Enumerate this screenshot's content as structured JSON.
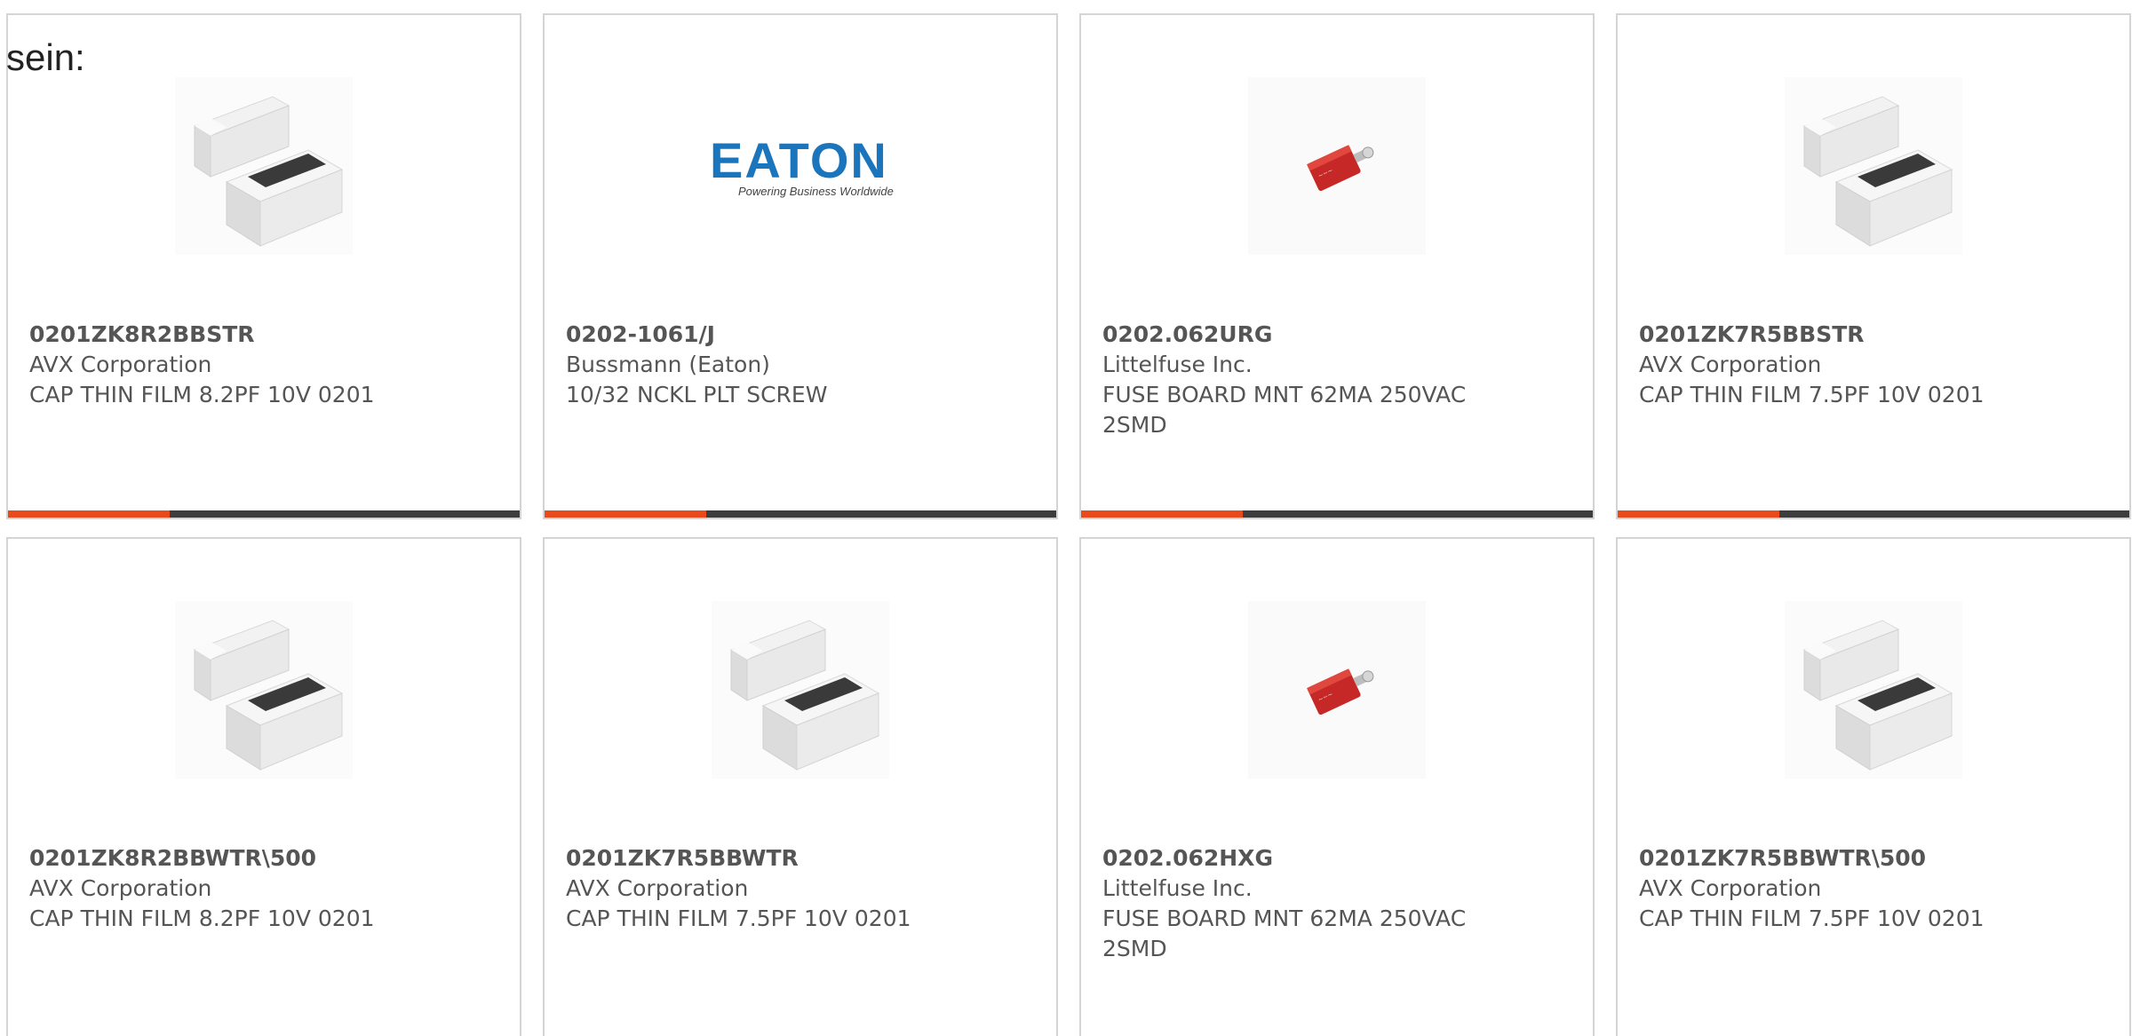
{
  "intro_text": "sein:",
  "colors": {
    "accent": "#e84a1c",
    "bar_dark": "#3d3d3d",
    "text": "#555555",
    "border": "#d4d4d4"
  },
  "products": [
    {
      "part_number": "0201ZK8R2BBSTR",
      "manufacturer": "AVX Corporation",
      "description": "CAP THIN FILM 8.2PF 10V 0201",
      "image": "capacitor-chip-icon",
      "logo_text": "",
      "logo_tagline": ""
    },
    {
      "part_number": "0202-1061/J",
      "manufacturer": "Bussmann (Eaton)",
      "description": "10/32 NCKL PLT SCREW",
      "image": "eaton-logo",
      "logo_text": "EATON",
      "logo_tagline": "Powering Business Worldwide"
    },
    {
      "part_number": "0202.062URG",
      "manufacturer": "Littelfuse Inc.",
      "description": "FUSE BOARD MNT 62MA 250VAC 2SMD",
      "image": "fuse-icon",
      "logo_text": "",
      "logo_tagline": ""
    },
    {
      "part_number": "0201ZK7R5BBSTR",
      "manufacturer": "AVX Corporation",
      "description": "CAP THIN FILM 7.5PF 10V 0201",
      "image": "capacitor-chip-icon",
      "logo_text": "",
      "logo_tagline": ""
    },
    {
      "part_number": "0201ZK8R2BBWTR\\500",
      "manufacturer": "AVX Corporation",
      "description": "CAP THIN FILM 8.2PF 10V 0201",
      "image": "capacitor-chip-icon",
      "logo_text": "",
      "logo_tagline": ""
    },
    {
      "part_number": "0201ZK7R5BBWTR",
      "manufacturer": "AVX Corporation",
      "description": "CAP THIN FILM 7.5PF 10V 0201",
      "image": "capacitor-chip-icon",
      "logo_text": "",
      "logo_tagline": ""
    },
    {
      "part_number": "0202.062HXG",
      "manufacturer": "Littelfuse Inc.",
      "description": "FUSE BOARD MNT 62MA 250VAC 2SMD",
      "image": "fuse-icon",
      "logo_text": "",
      "logo_tagline": ""
    },
    {
      "part_number": "0201ZK7R5BBWTR\\500",
      "manufacturer": "AVX Corporation",
      "description": "CAP THIN FILM 7.5PF 10V 0201",
      "image": "capacitor-chip-icon",
      "logo_text": "",
      "logo_tagline": ""
    }
  ]
}
